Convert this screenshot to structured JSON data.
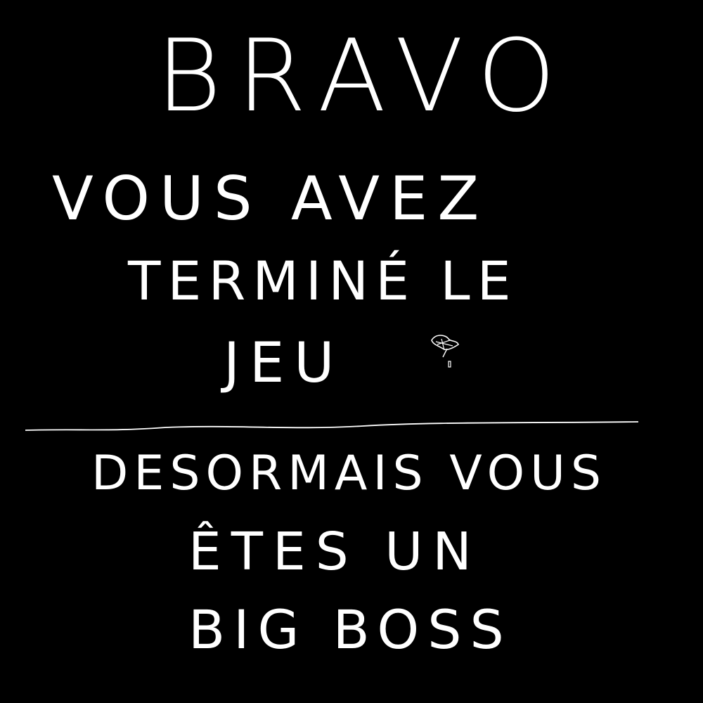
{
  "message": {
    "title": "BRAVO",
    "line_1": "VOUS AVEZ",
    "line_2": "TERMINÉ LE",
    "line_3": "JEU",
    "line_4": "DESORMAIS VOUS",
    "line_5": "ÊTES UN",
    "line_6": "BIG BOSS"
  },
  "colors": {
    "background": "#000000",
    "ink": "#ffffff"
  },
  "icons": {
    "scribble": "heart-scribble-icon"
  }
}
